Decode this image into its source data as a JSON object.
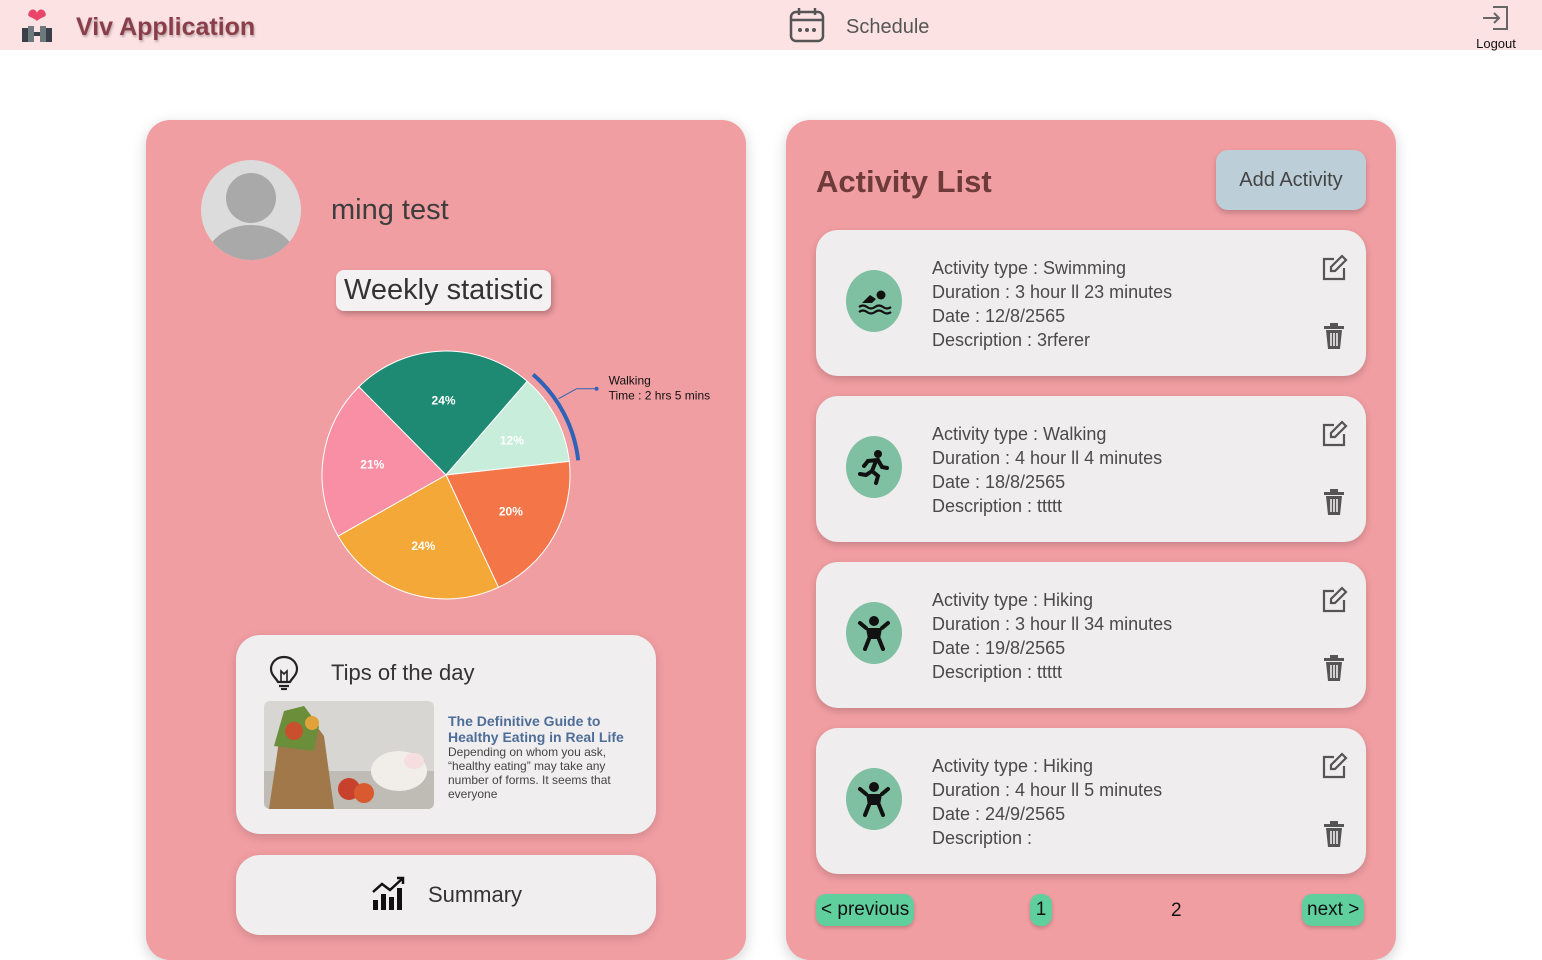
{
  "header": {
    "app_title": "Viv Application",
    "schedule_label": "Schedule",
    "logout_label": "Logout",
    "icons": [
      "heart-dumbbell-logo",
      "calendar-icon",
      "logout-icon"
    ]
  },
  "profile": {
    "name": "ming test",
    "weekly_title": "Weekly statistic"
  },
  "chart_data": {
    "type": "pie",
    "slices": [
      {
        "label": "24%",
        "value": 24,
        "color": "#1f8a74"
      },
      {
        "label": "12%",
        "value": 12,
        "color": "#c8eedb"
      },
      {
        "label": "20%",
        "value": 20,
        "color": "#f47548"
      },
      {
        "label": "24%",
        "value": 24,
        "color": "#f4a837"
      },
      {
        "label": "21%",
        "value": 21,
        "color": "#f98fa5"
      }
    ],
    "tooltip": {
      "line1": "Walking",
      "line2": "Time : 2 hrs 5 mins"
    },
    "highlight_color": "#2e63b8"
  },
  "tips": {
    "title": "Tips of the day",
    "article_title": "The Definitive Guide to Healthy Eating in Real Life",
    "article_snippet": "Depending on whom you ask, “healthy eating” may take any number of forms. It seems that everyone"
  },
  "summary": {
    "label": "Summary"
  },
  "activity_list": {
    "title": "Activity List",
    "add_label": "Add Activity",
    "items": [
      {
        "type": "Activity type : Swimming",
        "duration": "Duration : 3 hour ll 23 minutes",
        "date": "Date : 12/8/2565",
        "description": "Description : 3rferer",
        "icon": "swimming-icon"
      },
      {
        "type": "Activity type : Walking",
        "duration": "Duration : 4 hour ll 4 minutes",
        "date": "Date : 18/8/2565",
        "description": "Description : ttttt",
        "icon": "running-icon"
      },
      {
        "type": "Activity type : Hiking",
        "duration": "Duration : 3 hour ll 34 minutes",
        "date": "Date : 19/8/2565",
        "description": "Description : ttttt",
        "icon": "hiking-icon"
      },
      {
        "type": "Activity type : Hiking",
        "duration": "Duration : 4 hour ll 5 minutes",
        "date": "Date : 24/9/2565",
        "description": "Description :",
        "icon": "hiking-icon"
      }
    ]
  },
  "pagination": {
    "previous": "< previous",
    "page1": "1",
    "page2": "2",
    "next": "next >"
  },
  "colors": {
    "header_bg": "#fde2e4",
    "card_bg": "#f19ea2",
    "accent_green": "#5fcf9e",
    "icon_circle": "#7fbfa2",
    "add_button": "#bccfd8"
  }
}
